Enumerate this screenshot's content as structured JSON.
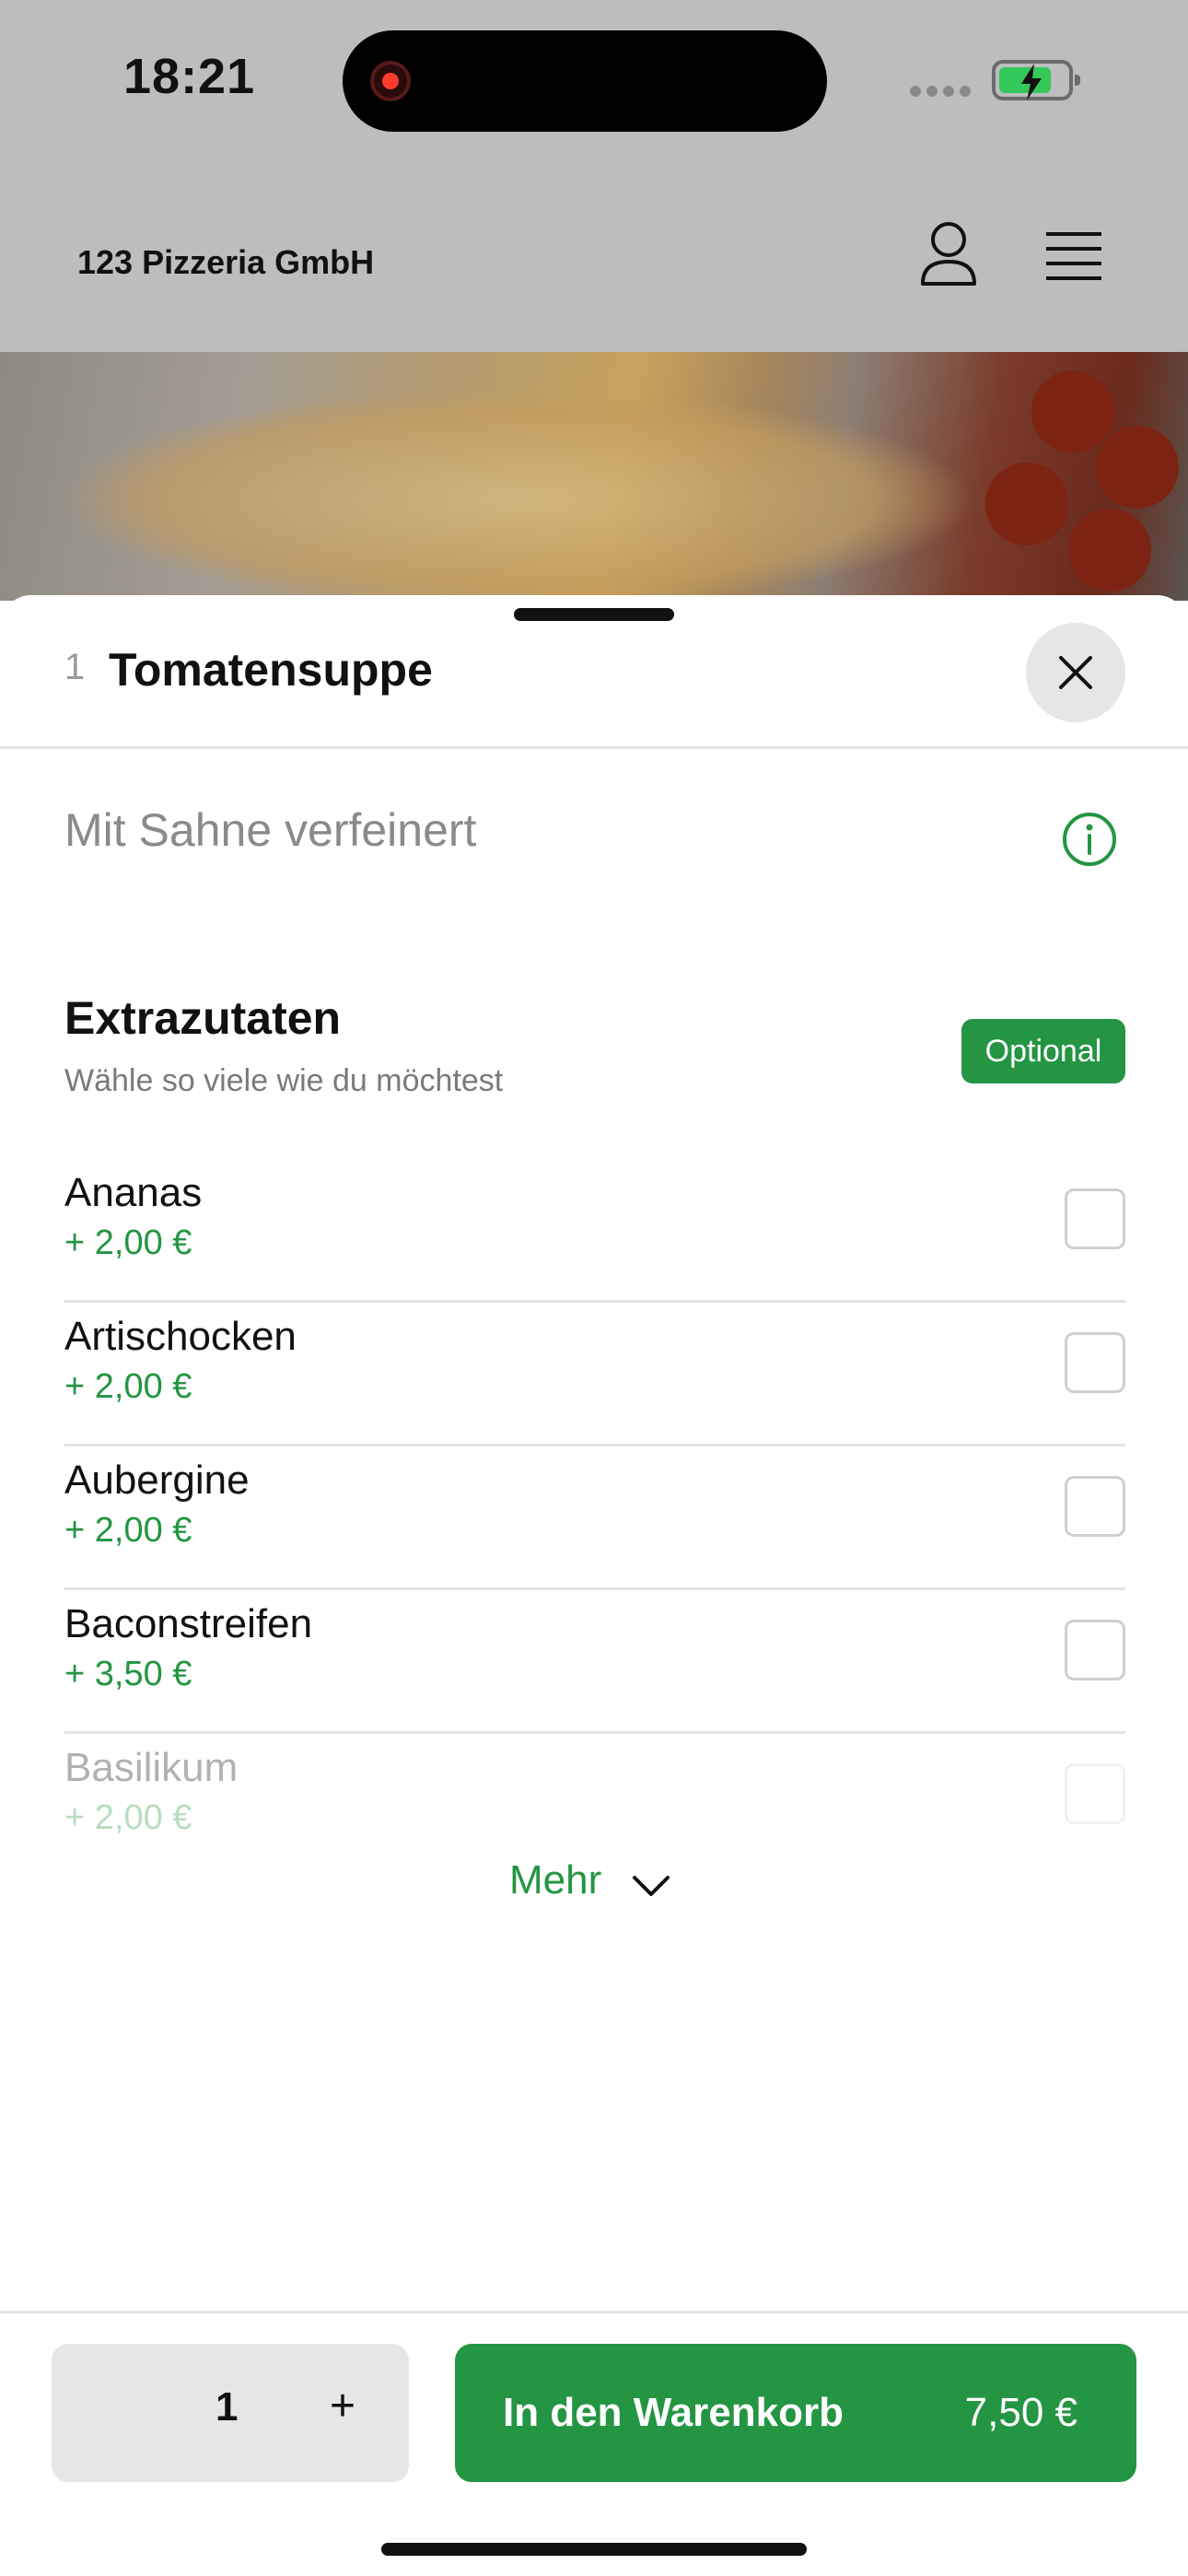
{
  "status_bar": {
    "time": "18:21",
    "battery_level": 0.75
  },
  "header": {
    "title": "123 Pizzeria GmbH"
  },
  "sheet": {
    "item_number": "1",
    "item_title": "Tomatensuppe",
    "description": "Mit Sahne verfeinert",
    "section": {
      "title": "Extrazutaten",
      "subtitle": "Wähle so viele wie du möchtest",
      "badge": "Optional"
    },
    "options": [
      {
        "name": "Ananas",
        "price": "+ 2,00 €"
      },
      {
        "name": "Artischocken",
        "price": "+ 2,00 €"
      },
      {
        "name": "Aubergine",
        "price": "+ 2,00 €"
      },
      {
        "name": "Baconstreifen",
        "price": "+ 3,50 €"
      },
      {
        "name": "Basilikum",
        "price": "+ 2,00 €"
      }
    ],
    "more_label": "Mehr"
  },
  "footer": {
    "quantity": "1",
    "plus_label": "+",
    "cart_label": "In den Warenkorb",
    "cart_price": "7,50 €"
  },
  "colors": {
    "accent": "#239543",
    "dim_background": "#bdbdbd"
  }
}
